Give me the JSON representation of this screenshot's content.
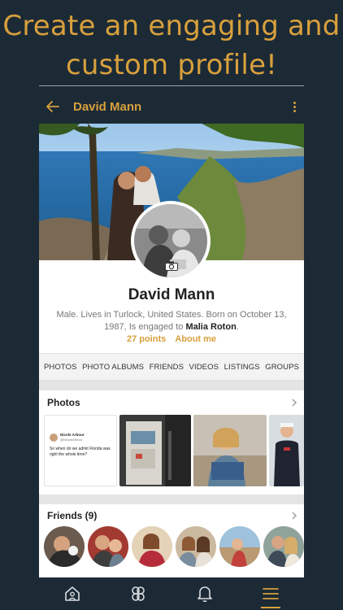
{
  "promo": {
    "line1": "Create an engaging and",
    "line2": "custom profile!"
  },
  "appbar": {
    "back_icon": "arrow-left-icon",
    "title": "David Mann",
    "menu_icon": "more-vertical-icon"
  },
  "profile": {
    "name": "David Mann",
    "bio": "Male. Lives in Turlock, United States. Born on October 13, 1987, Is engaged to",
    "partner": "Malia Roton",
    "bio_end": ".",
    "points": "27 points",
    "about": "About me"
  },
  "tabs": [
    "PHOTOS",
    "PHOTO ALBUMS",
    "FRIENDS",
    "VIDEOS",
    "LISTINGS",
    "GROUPS"
  ],
  "photos": {
    "title": "Photos",
    "tweet": {
      "author": "Nicole Arbour",
      "handle": "@NicoleArbour",
      "text": "So when do we admit Florida was right the whole time?"
    }
  },
  "friends": {
    "title": "Friends (9)"
  },
  "bottom_nav": {
    "items": [
      "home-icon",
      "groups-icon",
      "bell-icon",
      "menu-icon"
    ],
    "active": "menu-icon"
  },
  "colors": {
    "accent": "#d8a03c",
    "background": "#1c2a36"
  }
}
